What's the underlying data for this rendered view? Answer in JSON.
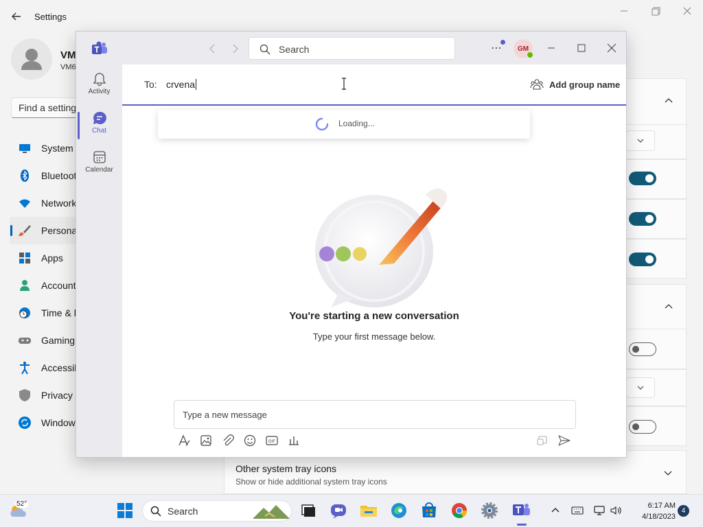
{
  "settings": {
    "title": "Settings",
    "profile": {
      "name": "VM",
      "email": "VM6"
    },
    "search_placeholder": "Find a setting",
    "nav": [
      {
        "label": "System",
        "icon": "system-icon"
      },
      {
        "label": "Bluetooth & devices",
        "icon": "bluetooth-icon"
      },
      {
        "label": "Network & internet",
        "icon": "wifi-icon"
      },
      {
        "label": "Personalization",
        "icon": "brush-icon",
        "active": true
      },
      {
        "label": "Apps",
        "icon": "apps-icon"
      },
      {
        "label": "Accounts",
        "icon": "account-icon"
      },
      {
        "label": "Time & language",
        "icon": "clock-globe-icon"
      },
      {
        "label": "Gaming",
        "icon": "gamepad-icon"
      },
      {
        "label": "Accessibility",
        "icon": "accessibility-icon"
      },
      {
        "label": "Privacy & security",
        "icon": "shield-icon"
      },
      {
        "label": "Windows Update",
        "icon": "update-icon"
      }
    ],
    "tray_row": {
      "title": "Other system tray icons",
      "subtitle": "Show or hide additional system tray icons"
    },
    "accent_color": "#115b78"
  },
  "teams": {
    "search_placeholder": "Search",
    "avatar_initials": "GM",
    "rail": [
      {
        "label": "Activity",
        "icon": "bell-icon"
      },
      {
        "label": "Chat",
        "icon": "chat-icon",
        "active": true
      },
      {
        "label": "Calendar",
        "icon": "calendar-icon"
      }
    ],
    "to_label": "To:",
    "to_value": "crvena",
    "add_group_name": "Add group name",
    "loading_text": "Loading...",
    "conversation_title": "You're starting a new conversation",
    "conversation_subtitle": "Type your first message below.",
    "compose_placeholder": "Type a new message",
    "accent_color": "#5b5fc7"
  },
  "taskbar": {
    "weather_temp": "52°",
    "search_label": "Search",
    "time": "6:17 AM",
    "date": "4/18/2023",
    "notification_count": "4"
  }
}
